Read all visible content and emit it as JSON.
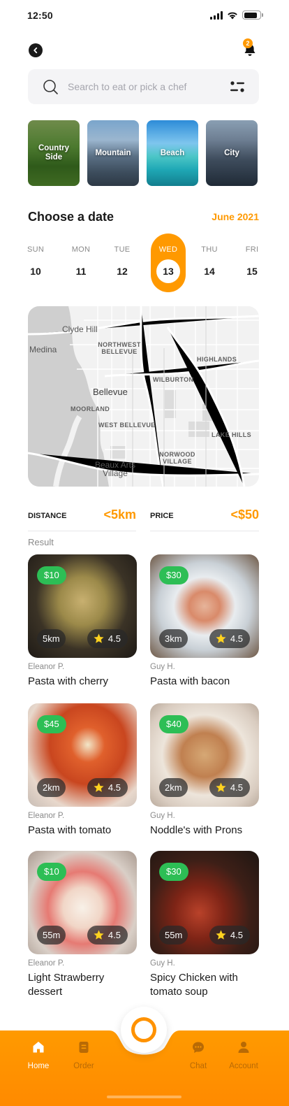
{
  "status_bar": {
    "time": "12:50"
  },
  "header": {
    "notification_count": "2"
  },
  "search": {
    "placeholder": "Search to eat or pick a chef"
  },
  "categories": [
    {
      "label": "Country Side"
    },
    {
      "label": "Mountain"
    },
    {
      "label": "Beach"
    },
    {
      "label": "City"
    }
  ],
  "date_picker": {
    "title": "Choose a date",
    "month": "June 2021",
    "days": [
      {
        "name": "SUN",
        "date": "10"
      },
      {
        "name": "MON",
        "date": "11"
      },
      {
        "name": "TUE",
        "date": "12"
      },
      {
        "name": "WED",
        "date": "13",
        "selected": true
      },
      {
        "name": "THU",
        "date": "14"
      },
      {
        "name": "FRI",
        "date": "15"
      }
    ]
  },
  "map": {
    "labels": {
      "clyde_hill": "Clyde Hill",
      "medina": "Medina",
      "northwest_bellevue": "NORTHWEST BELLEVUE",
      "highlands": "HIGHLANDS",
      "wilburton": "WILBURTON",
      "bellevue": "Bellevue",
      "moorland": "MOORLAND",
      "west_bellevue": "WEST BELLEVUE",
      "lake_hills": "LAKE HILLS",
      "norwood_village": "NORWOOD VILLAGE",
      "beaux_arts": "Beaux Arts Village"
    }
  },
  "filters": {
    "distance": {
      "label": "DISTANCE",
      "value": "<5km"
    },
    "price": {
      "label": "PRICE",
      "value": "<$50"
    }
  },
  "results": {
    "label": "Result",
    "items": [
      {
        "price": "$10",
        "distance": "5km",
        "rating": "4.5",
        "chef": "Eleanor P.",
        "name": "Pasta with cherry"
      },
      {
        "price": "$30",
        "distance": "3km",
        "rating": "4.5",
        "chef": "Guy H.",
        "name": "Pasta with bacon"
      },
      {
        "price": "$45",
        "distance": "2km",
        "rating": "4.5",
        "chef": "Eleanor P.",
        "name": "Pasta with tomato"
      },
      {
        "price": "$40",
        "distance": "2km",
        "rating": "4.5",
        "chef": "Guy H.",
        "name": "Noddle's with Prons"
      },
      {
        "price": "$10",
        "distance": "55m",
        "rating": "4.5",
        "chef": "Eleanor P.",
        "name": "Light Strawberry dessert"
      },
      {
        "price": "$30",
        "distance": "55m",
        "rating": "4.5",
        "chef": "Guy H.",
        "name": "Spicy Chicken with tomato soup"
      }
    ]
  },
  "tab_bar": {
    "tabs": [
      {
        "label": "Home",
        "icon": "home-icon",
        "active": true
      },
      {
        "label": "Order",
        "icon": "order-icon"
      },
      {
        "label": "Chat",
        "icon": "chat-icon"
      },
      {
        "label": "Account",
        "icon": "account-icon"
      }
    ]
  },
  "colors": {
    "accent": "#ff9900",
    "price_badge": "#2dbe55",
    "text": "#1a1a1a",
    "muted": "#8a8a8a"
  }
}
